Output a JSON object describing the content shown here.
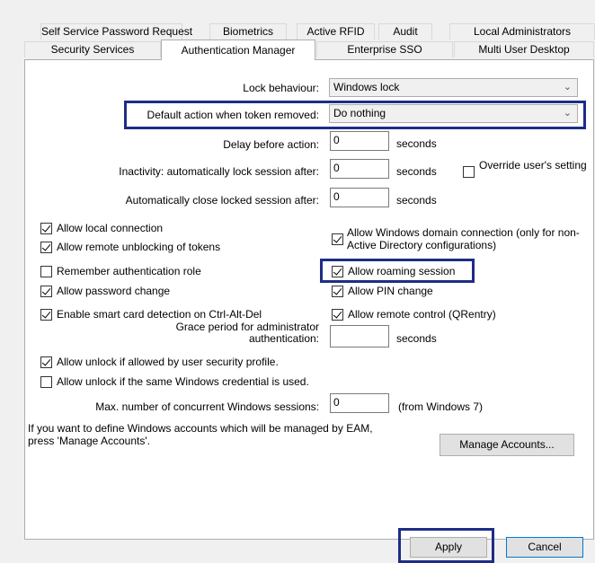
{
  "tabs": {
    "row1": [
      "Self Service Password Request",
      "Biometrics",
      "Active RFID",
      "Audit",
      "Local Administrators"
    ],
    "row2": [
      "Security Services",
      "Authentication Manager",
      "Enterprise SSO",
      "Multi User Desktop"
    ],
    "active": "Authentication Manager"
  },
  "form": {
    "lock_behaviour_label": "Lock behaviour:",
    "lock_behaviour_value": "Windows lock",
    "default_action_label": "Default action when token removed:",
    "default_action_value": "Do nothing",
    "delay_label": "Delay before action:",
    "delay_value": "0",
    "delay_unit": "seconds",
    "inactivity_label": "Inactivity: automatically lock session after:",
    "inactivity_value": "0",
    "inactivity_unit": "seconds",
    "override_label": "Override user's setting",
    "auto_close_label": "Automatically close locked session after:",
    "auto_close_value": "0",
    "auto_close_unit": "seconds",
    "grace_label": "Grace period for administrator authentication:",
    "grace_value": "",
    "grace_unit": "seconds",
    "max_sessions_label": "Max. number of concurrent Windows sessions:",
    "max_sessions_value": "0",
    "max_sessions_note": "(from Windows 7)",
    "info_text": "If you want to define Windows accounts which will be managed by EAM, press 'Manage Accounts'.",
    "manage_accounts": "Manage Accounts..."
  },
  "checkboxes": {
    "allow_local": {
      "label": "Allow local connection",
      "checked": true
    },
    "allow_remote_unblock": {
      "label": "Allow remote unblocking of tokens",
      "checked": true
    },
    "remember_role": {
      "label": "Remember authentication role",
      "checked": false
    },
    "allow_password_change": {
      "label": "Allow password change",
      "checked": true
    },
    "smart_card": {
      "label": "Enable smart card detection on Ctrl-Alt-Del",
      "checked": true
    },
    "allow_unlock_profile": {
      "label": "Allow unlock if allowed by user security profile.",
      "checked": true
    },
    "allow_unlock_same": {
      "label": "Allow unlock if the same Windows credential is used.",
      "checked": false
    },
    "domain_connection": {
      "label": "Allow Windows domain connection (only for non-Active Directory configurations)",
      "checked": true
    },
    "roaming": {
      "label": "Allow roaming session",
      "checked": true
    },
    "pin_change": {
      "label": "Allow PIN change",
      "checked": true
    },
    "remote_control": {
      "label": "Allow remote control (QRentry)",
      "checked": true
    },
    "override": {
      "checked": false
    }
  },
  "buttons": {
    "apply": "Apply",
    "cancel": "Cancel"
  },
  "colors": {
    "highlight": "#1e2d87"
  }
}
